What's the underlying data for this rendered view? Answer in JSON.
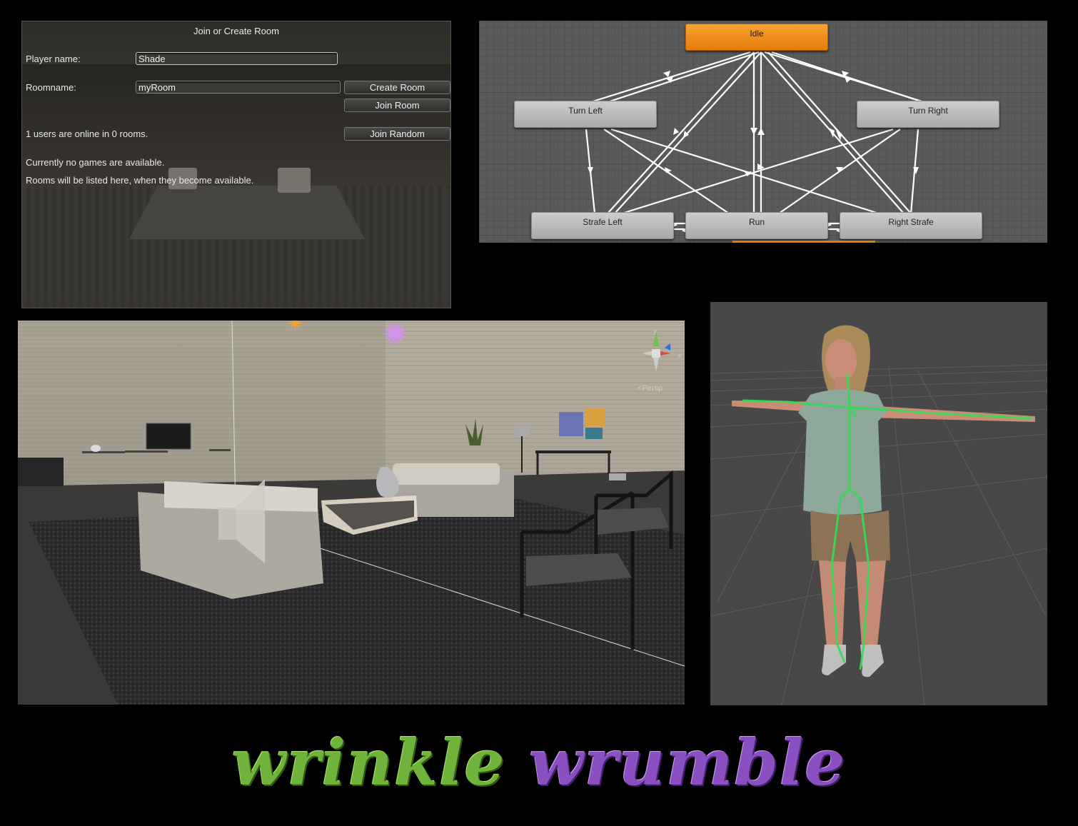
{
  "lobby": {
    "window_title": "Join or Create Room",
    "player_name_label": "Player name:",
    "player_name_value": "Shade",
    "roomname_label": "Roomname:",
    "roomname_value": "myRoom",
    "create_room_label": "Create Room",
    "join_room_label": "Join Room",
    "join_random_label": "Join Random",
    "online_status": "1 users are online in 0 rooms.",
    "no_games_text": "Currently no games are available.",
    "rooms_hint_text": "Rooms will be listed here, when they become available."
  },
  "animator": {
    "states": [
      "Idle",
      "Turn Left",
      "Turn Right",
      "Strafe Left",
      "Run",
      "Right Strafe"
    ],
    "default_state": "Idle",
    "colors": {
      "default_state": "#f08c1c",
      "state": "#b8b8b8",
      "transition": "#ffffff"
    }
  },
  "scene_view": {
    "projection_label": "Persp",
    "gizmo_axes": [
      "y",
      "x"
    ],
    "icons": [
      "sun-light-icon",
      "point-light-icon",
      "audio-source-icon",
      "scene-gizmo-icon"
    ]
  },
  "character_view": {
    "bone_color": "#33dd55"
  },
  "title": {
    "word1": "wrinkle",
    "word2": "wrumble",
    "color1": "#6fb33a",
    "color2": "#8a4fc0"
  }
}
